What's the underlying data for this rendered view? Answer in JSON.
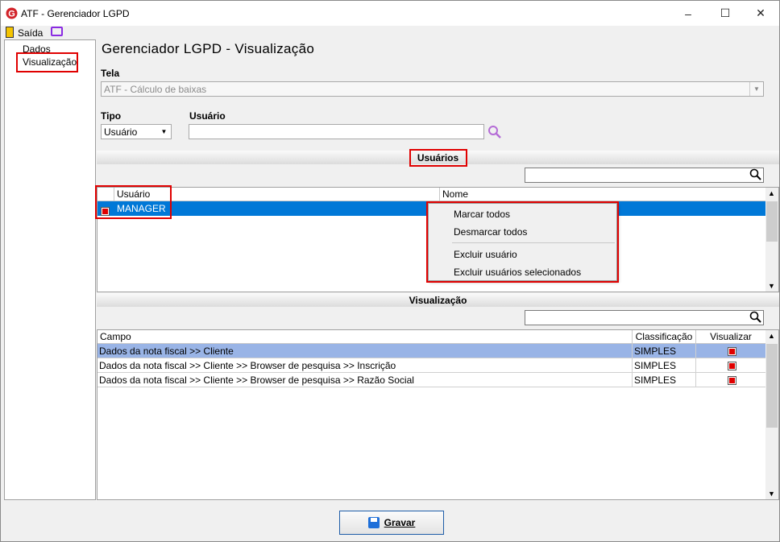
{
  "window": {
    "title": "ATF - Gerenciador LGPD",
    "min": "–",
    "max": "☐",
    "close": "✕"
  },
  "toolbar": {
    "exit_label": "Saída"
  },
  "tree": {
    "items": [
      "Dados",
      "Visualização"
    ]
  },
  "main": {
    "heading": "Gerenciador LGPD - Visualização",
    "tela_label": "Tela",
    "tela_value": "ATF - Cálculo de baixas",
    "tipo_label": "Tipo",
    "tipo_value": "Usuário",
    "usuario_label": "Usuário",
    "usuario_value": ""
  },
  "usuarios": {
    "section_label": "Usuários",
    "search_value": "",
    "columns": [
      "Usuário",
      "Nome"
    ],
    "rows": [
      {
        "checked": true,
        "usuario": "MANAGER",
        "nome": ""
      }
    ]
  },
  "context_menu": {
    "items": [
      "Marcar todos",
      "Desmarcar todos",
      "Excluir usuário",
      "Excluir usuários selecionados"
    ]
  },
  "visualizacao": {
    "section_label": "Visualização",
    "search_value": "",
    "columns": [
      "Campo",
      "Classificação",
      "Visualizar"
    ],
    "rows": [
      {
        "campo": "Dados da nota fiscal >> Cliente",
        "classificacao": "SIMPLES",
        "visualizar": true
      },
      {
        "campo": "Dados da nota fiscal >> Cliente >> Browser de pesquisa >> Inscrição",
        "classificacao": "SIMPLES",
        "visualizar": true
      },
      {
        "campo": "Dados da nota fiscal >> Cliente >> Browser de pesquisa >> Razão Social",
        "classificacao": "SIMPLES",
        "visualizar": true
      }
    ]
  },
  "footer": {
    "save_label": "Gravar"
  },
  "colors": {
    "selection": "#0078d7",
    "selection_light": "#99b4e6",
    "highlight_box": "#e00000",
    "save_border": "#1e5da8"
  }
}
